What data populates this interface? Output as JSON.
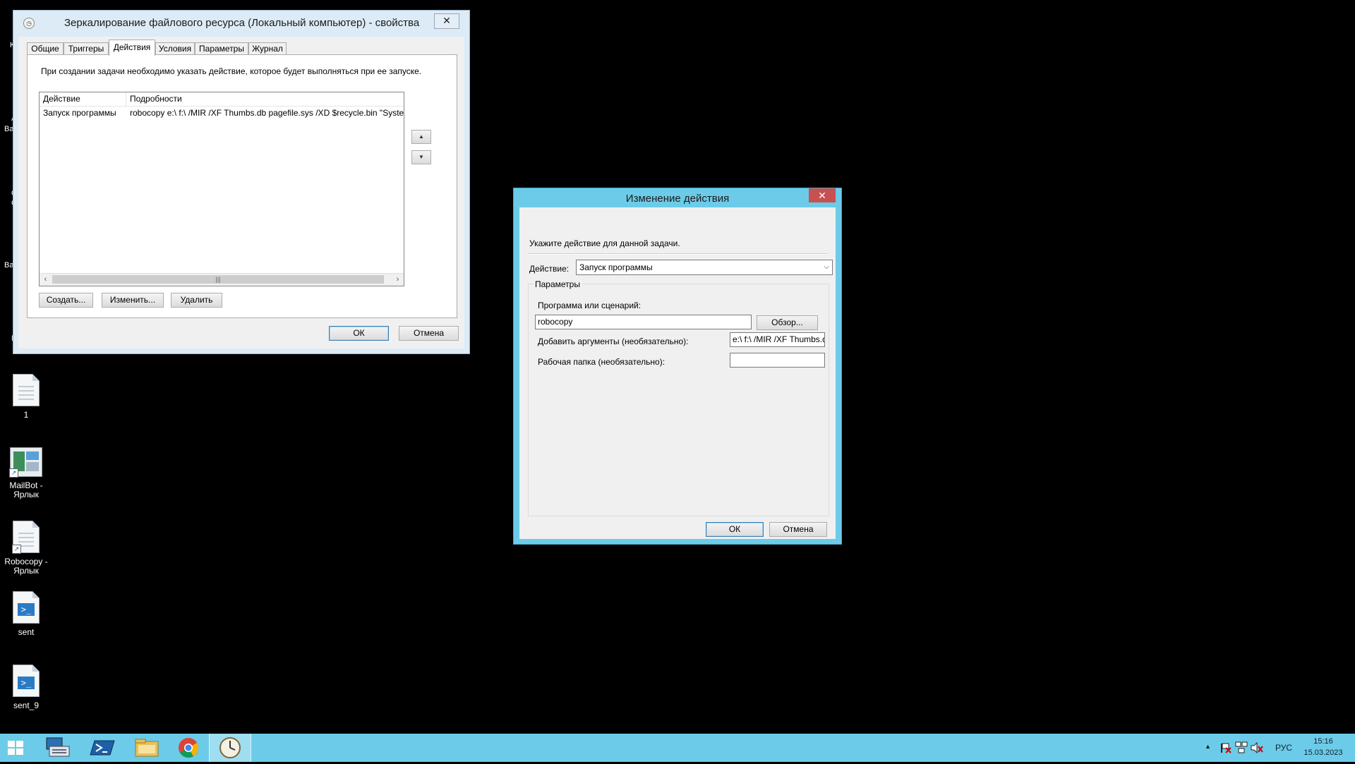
{
  "desktop": {
    "partial_labels": [
      "К",
      "А",
      "Вас",
      "С",
      "С",
      "Вас",
      "М"
    ],
    "icons": [
      {
        "label": "1"
      },
      {
        "label": "MailBot - Ярлык"
      },
      {
        "label": "Robocopy - Ярлык"
      },
      {
        "label": "sent"
      },
      {
        "label": "sent_9"
      }
    ]
  },
  "properties_window": {
    "title": "Зеркалирование файлового ресурса (Локальный компьютер) - свойства",
    "close_glyph": "✕",
    "tabs": [
      "Общие",
      "Триггеры",
      "Действия",
      "Условия",
      "Параметры",
      "Журнал"
    ],
    "active_tab": "Действия",
    "description": "При создании задачи необходимо указать действие, которое будет выполняться при ее запуске.",
    "list": {
      "columns": [
        "Действие",
        "Подробности"
      ],
      "rows": [
        {
          "action": "Запуск программы",
          "details": "robocopy e:\\ f:\\ /MIR /XF Thumbs.db pagefile.sys /XD $recycle.bin \"System Volume Information\""
        }
      ]
    },
    "move_up_glyph": "▲",
    "move_down_glyph": "▼",
    "buttons": {
      "create": "Создать...",
      "edit": "Изменить...",
      "delete": "Удалить"
    },
    "ok": "ОК",
    "cancel": "Отмена"
  },
  "edit_action_dialog": {
    "title": "Изменение действия",
    "close_glyph": "✕",
    "instruction": "Укажите действие для данной задачи.",
    "action_label": "Действие:",
    "action_value": "Запуск программы",
    "group_title": "Параметры",
    "program_label": "Программа или сценарий:",
    "program_value": "robocopy",
    "browse_button": "Обзор...",
    "arguments_label": "Добавить аргументы (необязательно):",
    "arguments_value": "e:\\ f:\\ /MIR /XF Thumbs.db pagefile.sys /XD $recycle.bin",
    "start_in_label": "Рабочая папка (необязательно):",
    "start_in_value": "",
    "ok": "ОК",
    "cancel": "Отмена"
  },
  "taskbar": {
    "items": [
      "start-button",
      "server-manager",
      "powershell",
      "file-explorer",
      "chrome",
      "task-scheduler"
    ],
    "language": "РУС",
    "time": "15:16",
    "date": "15.03.2023",
    "tray_up_glyph": "▲"
  },
  "colors": {
    "accent": "#6ccbe8",
    "desktop": "#000000",
    "close_red": "#c75050",
    "window_inactive_frame": "#dcebf6"
  }
}
